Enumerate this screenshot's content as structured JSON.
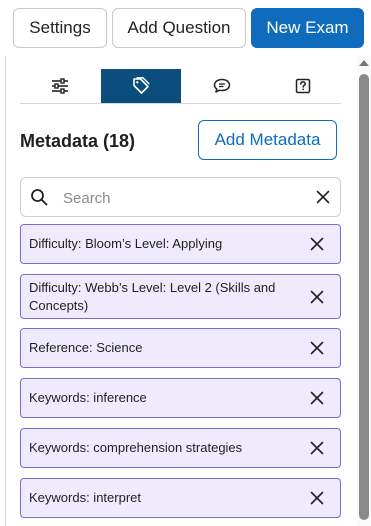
{
  "toolbar": {
    "settings_label": "Settings",
    "add_question_label": "Add Question",
    "new_exam_label": "New Exam"
  },
  "tabs": [
    {
      "icon": "sliders-icon",
      "active": false
    },
    {
      "icon": "tag-icon",
      "active": true
    },
    {
      "icon": "comment-icon",
      "active": false
    },
    {
      "icon": "question-icon",
      "active": false
    }
  ],
  "metadata": {
    "title": "Metadata (18)",
    "add_label": "Add Metadata",
    "search_placeholder": "Search",
    "items": [
      {
        "label": "Difficulty: Bloom’s Level: Applying"
      },
      {
        "label": "Difficulty: Webb’s Level: Level 2 (Skills and Concepts)"
      },
      {
        "label": "Reference: Science"
      },
      {
        "label": "Keywords: inference"
      },
      {
        "label": "Keywords: comprehension strategies"
      },
      {
        "label": "Keywords: interpret"
      }
    ]
  },
  "colors": {
    "primary": "#0f6cbd",
    "active_tab": "#0b4e7e",
    "tag_bg": "#efebfd",
    "tag_border": "#7f68d8"
  }
}
